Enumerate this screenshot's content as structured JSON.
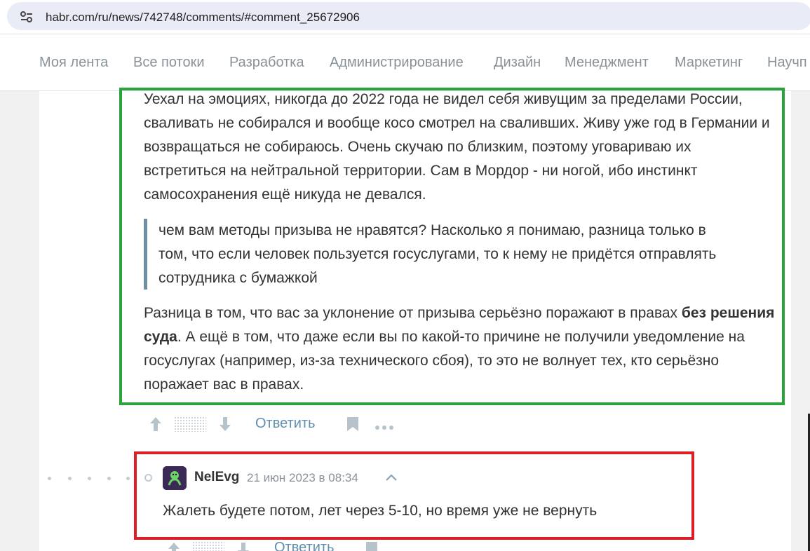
{
  "address_bar": {
    "url": "habr.com/ru/news/742748/comments/#comment_25672906",
    "site_info_icon": "tune-icon"
  },
  "nav": {
    "items": [
      "Моя лента",
      "Все потоки",
      "Разработка",
      "Администрирование",
      "Дизайн",
      "Менеджмент",
      "Маркетинг",
      "Научп"
    ]
  },
  "comment_main": {
    "paragraph1": "Уехал на эмоциях, никогда до 2022 года не видел себя живущим за пределами России, сваливать не собирался и вообще косо смотрел на сваливших. Живу уже год в Германии и возвращаться не собираюсь. Очень скучаю по близким, поэтому уговариваю их встретиться на нейтральной территории. Сам в Мордор - ни ногой, ибо инстинкт самосохранения ещё никуда не девался.",
    "quote": "чем вам методы призыва не нравятся? Насколько я понимаю, разница только в том, что если человек пользуется госуслугами, то к нему не придётся отправлять сотрудника с бумажкой",
    "paragraph2_before": "Разница в том, что вас за уклонение от призыва серьёзно поражают в правах ",
    "paragraph2_bold": "без решения суда",
    "paragraph2_after": ". А ещё в том, что даже если вы по какой-то причине не получили уведомление на госуслугах (например, из-за технического сбоя), то это не волнует тех, кто серьёзно поражает вас в правах.",
    "actions": {
      "reply_label": "Ответить",
      "icons": [
        "arrow-up-icon",
        "arrow-down-icon",
        "bookmark-icon",
        "more-icon"
      ]
    }
  },
  "comment_reply": {
    "username": "NelEvg",
    "timestamp": "21 июн 2023 в 08:34",
    "text": "Жалеть будете потом, лет через 5-10, но время уже не вернуть",
    "reply_label": "Ответить",
    "icons": [
      "avatar-icon",
      "chevron-up-icon"
    ]
  },
  "colors": {
    "highlight_green": "#2aa33b",
    "highlight_red": "#dc1f26",
    "link": "#5e8fb0",
    "quote_bar": "#6e8ea4"
  }
}
